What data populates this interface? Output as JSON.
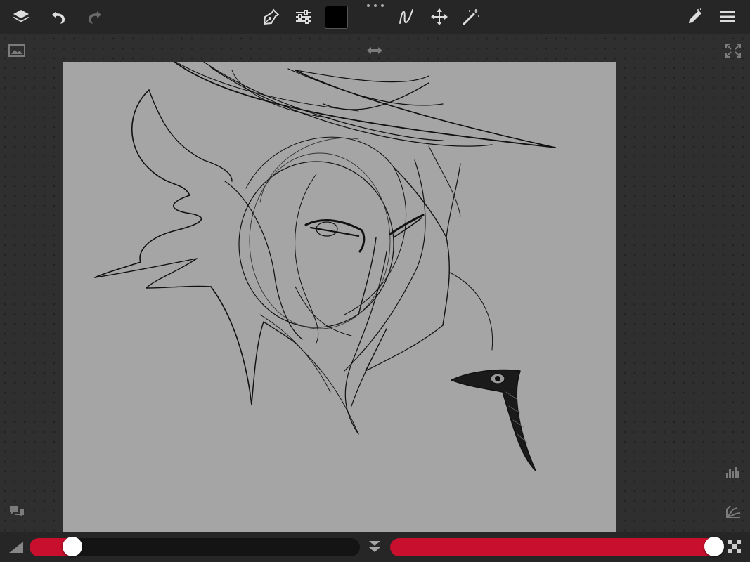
{
  "toolbar": {
    "left_icons": [
      "layers-icon",
      "undo-icon",
      "redo-icon"
    ],
    "center_icons": [
      "pen-tool-icon",
      "brush-settings-icon",
      "color-swatch",
      "stroke-smoothing-icon",
      "transform-move-icon",
      "magic-wand-icon"
    ],
    "right_icons": [
      "edit-pencil-icon",
      "menu-icon"
    ],
    "current_color": "#000000"
  },
  "workspace": {
    "canvas_background": "#a5a5a5",
    "side_icons": [
      "reference-image-icon",
      "flip-horizontal-icon",
      "fullscreen-icon",
      "histogram-icon",
      "color-palette-icon",
      "comments-icon"
    ]
  },
  "bottombar": {
    "brush_size_level": 0.13,
    "opacity_level": 0.98,
    "accent_color": "#c8102e"
  }
}
